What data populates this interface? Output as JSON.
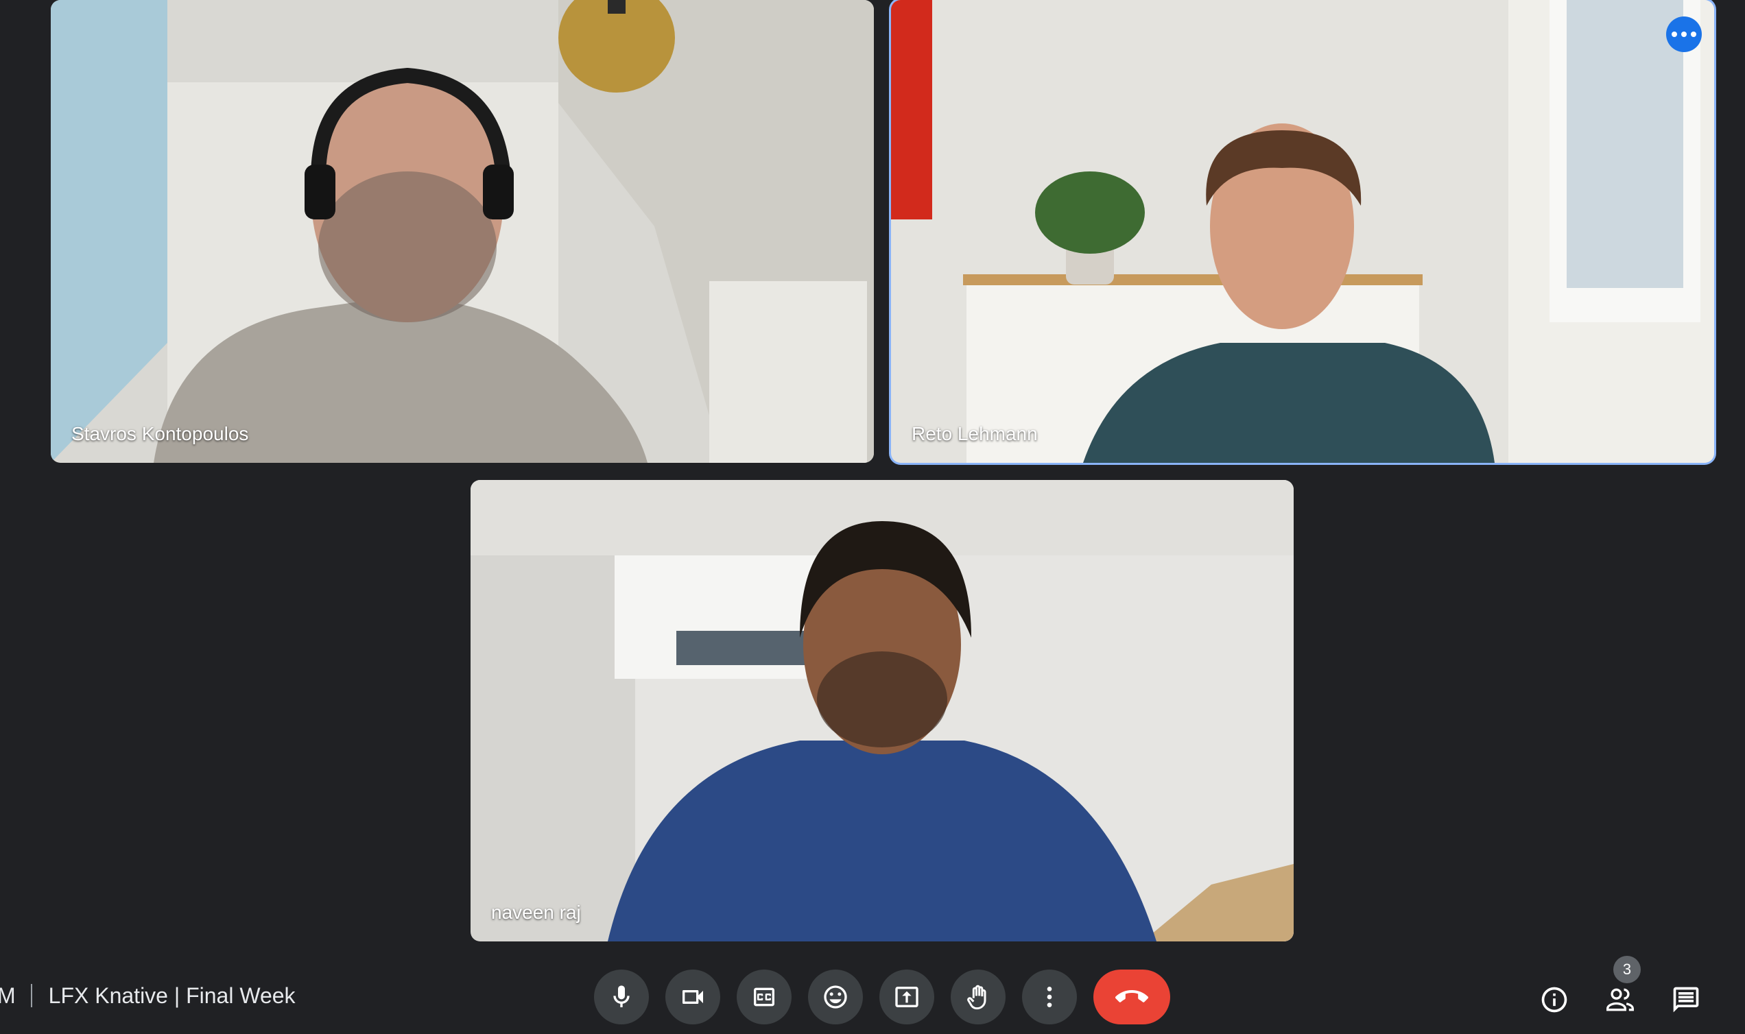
{
  "participants": [
    {
      "name": "Stavros Kontopoulos",
      "active": false
    },
    {
      "name": "Reto Lehmann",
      "active": true
    },
    {
      "name": "naveen raj",
      "active": false
    }
  ],
  "meeting": {
    "time_fragment": "M",
    "title": "LFX Knative | Final Week"
  },
  "controls": [
    "microphone",
    "camera",
    "captions",
    "emoji",
    "present",
    "raise-hand",
    "more-options",
    "leave-call"
  ],
  "side_panel": {
    "people_count": "3"
  },
  "colors": {
    "background": "#202124",
    "control": "#3c4043",
    "hangup": "#ea4335",
    "active_outline": "#8ab4f8",
    "accent": "#1a73e8"
  }
}
